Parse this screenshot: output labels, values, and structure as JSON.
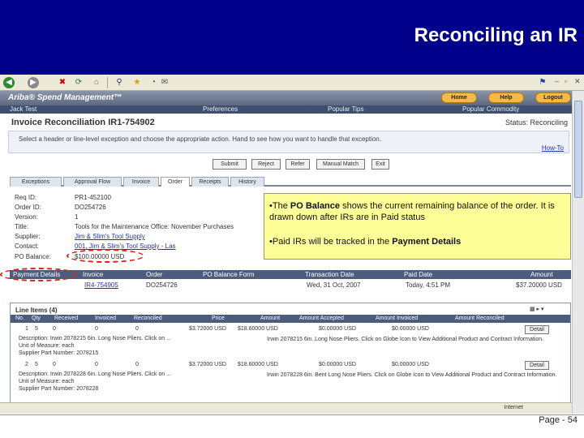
{
  "slide": {
    "title": "Reconciling an IR",
    "page_number": "Page - 54"
  },
  "app": {
    "brand": "Ariba® Spend Management™",
    "top_buttons": [
      "Home",
      "Help",
      "Logout"
    ],
    "nav": [
      "Jack Test",
      "Preferences",
      "Popular Tips",
      "Popular Commodity"
    ]
  },
  "page": {
    "title": "Invoice Reconciliation IR1-754902",
    "status": "Status: Reconciling",
    "instructions": "Select a header or line-level exception and choose the appropriate action. Hand to see how you want to handle that exception.",
    "how_to": "How-To"
  },
  "actions": [
    "Submit",
    "Reject",
    "Refer",
    "Manual Match",
    "Exit"
  ],
  "tabs": [
    "Exceptions",
    "Approval Flow",
    "Invoice",
    "Order",
    "Receipts",
    "History"
  ],
  "order_fields": [
    {
      "label": "Req ID:",
      "value": "PR1-452100",
      "link": false
    },
    {
      "label": "Order ID:",
      "value": "DO254726",
      "link": false
    },
    {
      "label": "Version:",
      "value": "1",
      "link": false
    },
    {
      "label": "Title:",
      "value": "Tools for the Maintenance Office: November Purchases",
      "link": false
    },
    {
      "label": "Supplier:",
      "value": "Jim & Slim's Tool Supply",
      "link": true
    },
    {
      "label": "Contact:",
      "value": "001, Jim & Slim's Tool Supply - Las",
      "link": true
    },
    {
      "label": "PO Balance:",
      "value": "$100.00000 USD",
      "link": false
    }
  ],
  "payment": {
    "label": "Payment Details",
    "headers": [
      "Invoice",
      "Order",
      "PO Balance Form",
      "Transaction Date",
      "Paid Date",
      "Amount"
    ],
    "row": [
      "IR4-754905",
      "DO254726",
      "",
      "Wed, 31 Oct, 2007",
      "Today, 4:51 PM",
      "$37.20000 USD"
    ]
  },
  "line_items": {
    "title": "Line Items (4)",
    "headers": [
      "No.",
      "Qty",
      "Received",
      "Invoiced",
      "Reconciled",
      "Price",
      "Amount",
      "Amount Accepted",
      "Amount Invoiced",
      "Amount Reconciled"
    ],
    "rows": [
      {
        "no": "1",
        "qty": "5",
        "received": "0",
        "invoiced": "0",
        "reconciled": "0",
        "price": "$3.72000 USD",
        "amount": "$18.60000 USD",
        "accepted": "$0.00000 USD",
        "amt_invoiced": "$0.00000 USD",
        "description": "Description: Irwin 2078215 6in. Long Nose Pliers. Click on ...",
        "uom": "Unit of Measure: each",
        "part": "Supplier Part Number: 2078215",
        "long_desc": "Irwin 2078215 6in. Long Nose Pliers. Click on Globe Icon to View Additional Product and Contract Information."
      },
      {
        "no": "2",
        "qty": "5",
        "received": "0",
        "invoiced": "0",
        "reconciled": "0",
        "price": "$3.72000 USD",
        "amount": "$18.60000 USD",
        "accepted": "$0.00000 USD",
        "amt_invoiced": "$0.00000 USD",
        "description": "Description: Irwin 2078228 6in. Long Nose Pliers. Click on ...",
        "uom": "Unit of Measure: each",
        "part": "Supplier Part Number: 2078228",
        "long_desc": "Irwin 2078228 6in. Bent Long Nose Pliers. Click on Globe Icon to View Additional Product and Contract Information."
      }
    ],
    "detail_label": "Detail"
  },
  "browser_status": "Internet",
  "callout": {
    "p1_pre": "The ",
    "p1_bold": "PO Balance",
    "p1_post": " shows the current remaining balance of the order. It is drawn down after IRs are in Paid status",
    "p2_pre": "Paid IRs will be tracked in the ",
    "p2_bold": "Payment Details"
  },
  "colors": {
    "banner": "#00008b",
    "callout": "#ffff99",
    "highlight_oval": "#e02020"
  }
}
